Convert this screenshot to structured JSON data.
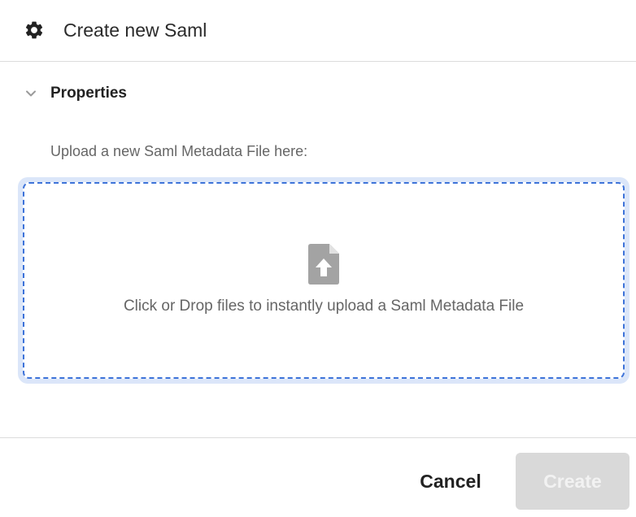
{
  "header": {
    "icon": "gear-icon",
    "title": "Create new Saml"
  },
  "properties": {
    "icon": "chevron-down-icon",
    "label": "Properties",
    "expanded": true
  },
  "upload": {
    "label": "Upload a new Saml Metadata File here:",
    "dropzone_icon": "file-upload-icon",
    "dropzone_text": "Click or Drop files to instantly upload a Saml Metadata File",
    "accent_color": "#3d73d9"
  },
  "footer": {
    "cancel_label": "Cancel",
    "create_label": "Create",
    "create_enabled": false
  }
}
